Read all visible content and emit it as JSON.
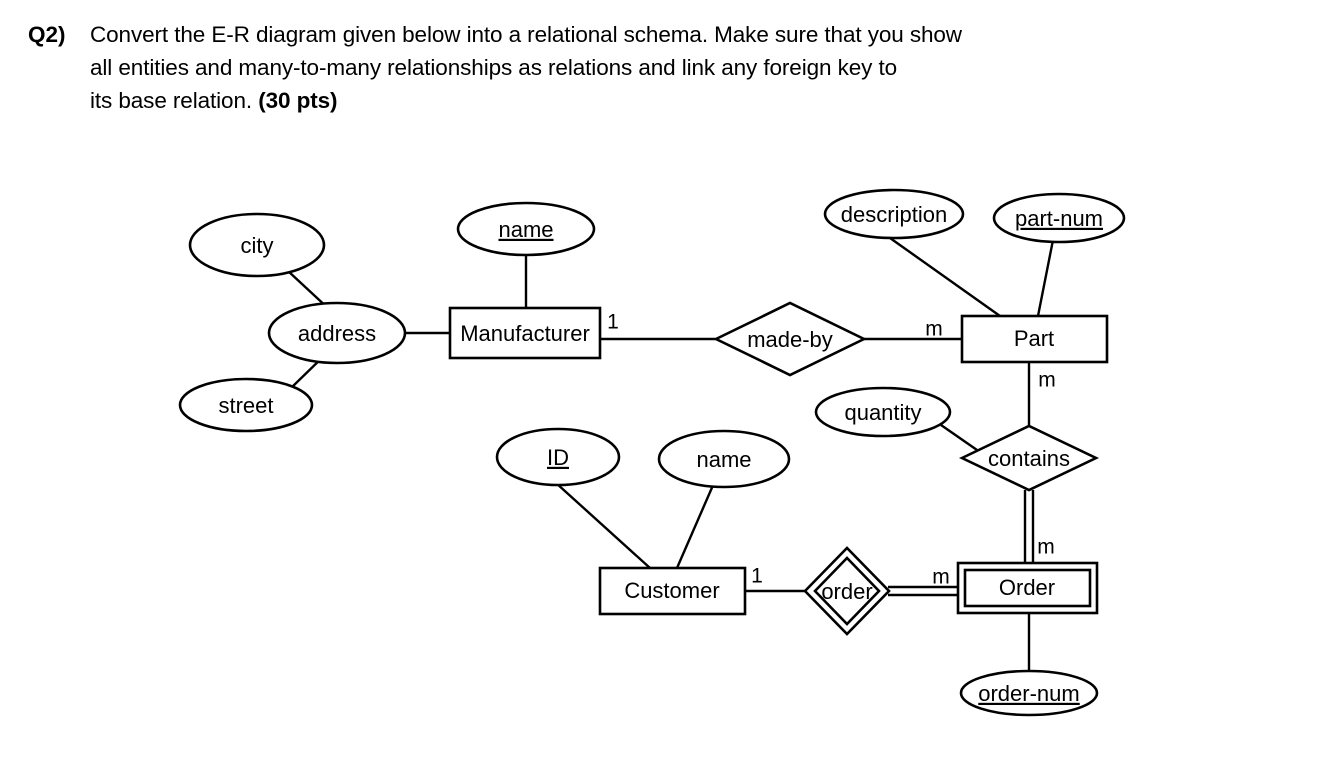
{
  "question": {
    "label": "Q2)",
    "line1": "Convert the E-R diagram given below into a relational schema. Make sure that you show",
    "line2": "all entities and many-to-many relationships as relations and link any foreign key to",
    "line3_prefix": "its base relation. ",
    "points": "(30 pts)"
  },
  "diagram": {
    "type": "er-diagram",
    "entities": [
      {
        "id": "manufacturer",
        "label": "Manufacturer",
        "weak": false
      },
      {
        "id": "part",
        "label": "Part",
        "weak": false
      },
      {
        "id": "customer",
        "label": "Customer",
        "weak": false
      },
      {
        "id": "order",
        "label": "Order",
        "weak": true
      }
    ],
    "relationships": [
      {
        "id": "made-by",
        "label": "made-by",
        "identifying": false
      },
      {
        "id": "contains",
        "label": "contains",
        "identifying": false
      },
      {
        "id": "order-rel",
        "label": "order",
        "identifying": true
      }
    ],
    "attributes": [
      {
        "id": "city",
        "label": "city",
        "key": false,
        "owner": "address"
      },
      {
        "id": "street",
        "label": "street",
        "key": false,
        "owner": "address"
      },
      {
        "id": "address",
        "label": "address",
        "key": false,
        "owner": "manufacturer"
      },
      {
        "id": "mfr-name",
        "label": "name",
        "key": true,
        "owner": "manufacturer"
      },
      {
        "id": "description",
        "label": "description",
        "key": false,
        "owner": "part"
      },
      {
        "id": "part-num",
        "label": "part-num",
        "key": true,
        "owner": "part"
      },
      {
        "id": "quantity",
        "label": "quantity",
        "key": false,
        "owner": "contains"
      },
      {
        "id": "cust-id",
        "label": "ID",
        "key": true,
        "owner": "customer"
      },
      {
        "id": "cust-name",
        "label": "name",
        "key": false,
        "owner": "customer"
      },
      {
        "id": "order-num",
        "label": "order-num",
        "key": true,
        "owner": "order"
      }
    ],
    "cardinalities": [
      {
        "id": "mfr-madeby",
        "label": "1",
        "from": "manufacturer",
        "to": "made-by"
      },
      {
        "id": "madeby-part",
        "label": "m",
        "from": "made-by",
        "to": "part"
      },
      {
        "id": "part-contains",
        "label": "m",
        "from": "part",
        "to": "contains"
      },
      {
        "id": "contains-order",
        "label": "m",
        "from": "contains",
        "to": "order"
      },
      {
        "id": "customer-order",
        "label": "1",
        "from": "customer",
        "to": "order-rel"
      },
      {
        "id": "orderrel-order",
        "label": "m",
        "from": "order-rel",
        "to": "order"
      }
    ],
    "colors": {
      "stroke": "#000000",
      "fill": "#ffffff",
      "text": "#000000"
    }
  }
}
